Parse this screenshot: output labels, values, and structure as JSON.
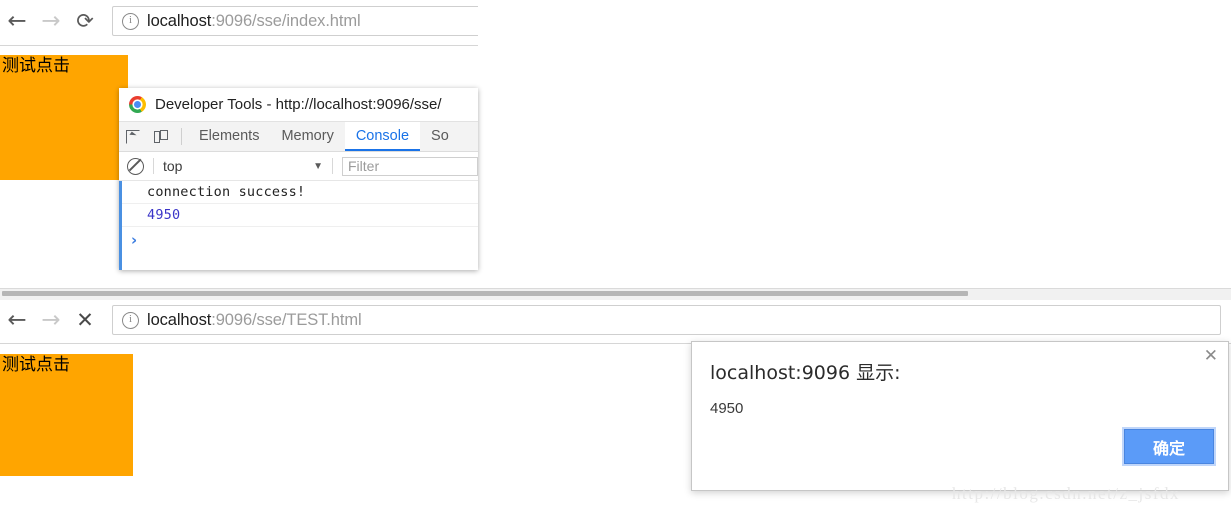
{
  "window_top": {
    "nav": {
      "back_icon": "←",
      "forward_icon": "→",
      "reload_icon": "⟳"
    },
    "omnibox": {
      "info_icon": "ⓘ",
      "host": "localhost",
      "path": ":9096/sse/index.html"
    },
    "page": {
      "test_button_label": "测试点击"
    }
  },
  "devtools": {
    "titlebar": {
      "logo_icon": "chrome-logo-icon",
      "title": "Developer Tools - http://localhost:9096/sse/"
    },
    "toolbar": {
      "inspect_icon": "inspect-element-icon",
      "device_icon": "device-toolbar-icon"
    },
    "tabs": [
      {
        "label": "Elements",
        "active": false
      },
      {
        "label": "Memory",
        "active": false
      },
      {
        "label": "Console",
        "active": true
      },
      {
        "label": "So",
        "active": false
      }
    ],
    "filterbar": {
      "clear_icon": "clear-console-icon",
      "context": "top",
      "caret_icon": "▼",
      "filter_placeholder": "Filter"
    },
    "console": {
      "rows": [
        {
          "text": "connection success!",
          "kind": "log"
        },
        {
          "text": "4950",
          "kind": "result"
        }
      ],
      "prompt_icon": "›"
    }
  },
  "window_bottom": {
    "nav": {
      "back_icon": "←",
      "forward_icon": "→",
      "stop_icon": "✕"
    },
    "omnibox": {
      "info_icon": "ⓘ",
      "host": "localhost",
      "path": ":9096/sse/TEST.html"
    },
    "page": {
      "test_button_label": "测试点击"
    }
  },
  "dialog": {
    "title": "localhost:9096 显示:",
    "message": "4950",
    "close_icon": "✕",
    "ok_label": "确定"
  },
  "watermark": {
    "text": "http://blog.csdn.net/z_jsfdx"
  },
  "colors": {
    "orange": "#FFA500",
    "accent_blue": "#1a73e8",
    "button_blue": "#5b9bf8",
    "console_result": "#3b35c8"
  }
}
